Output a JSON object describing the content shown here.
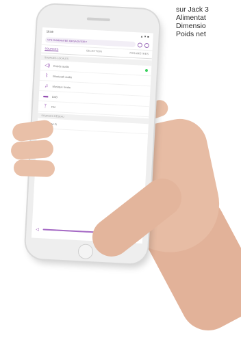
{
  "spec_lines": [
    "sur Jack 3",
    "Alimentat",
    "Dimensio",
    "Poids net"
  ],
  "phone": {
    "status_time": "10:58",
    "status_right": "▲ ▼ ■",
    "device_selector": "VYS GUARANTEE IOHSA DVS30 ▾",
    "tabs": [
      "SOURCES",
      "SELECTION",
      "PARAMÈTRES"
    ],
    "section_local": "SOURCES LOCALES",
    "section_network": "SOURCES RÉSEAU",
    "sources": [
      {
        "label": "Entrée audio",
        "icon": "speaker-icon",
        "active": true
      },
      {
        "label": "Bluetooth audio",
        "icon": "bluetooth-icon",
        "active": false
      },
      {
        "label": "Musique locale",
        "icon": "music-note-icon",
        "active": false
      },
      {
        "label": "DAB",
        "icon": "radio-icon",
        "active": false
      },
      {
        "label": "FM",
        "icon": "antenna-icon",
        "active": false
      }
    ],
    "network_sources": [
      {
        "label": "Wi-Fi",
        "icon": "wifi-icon"
      }
    ],
    "volume_level": 0.62,
    "accent_color": "#8e44ad",
    "active_dot_color": "#3bd15f"
  }
}
